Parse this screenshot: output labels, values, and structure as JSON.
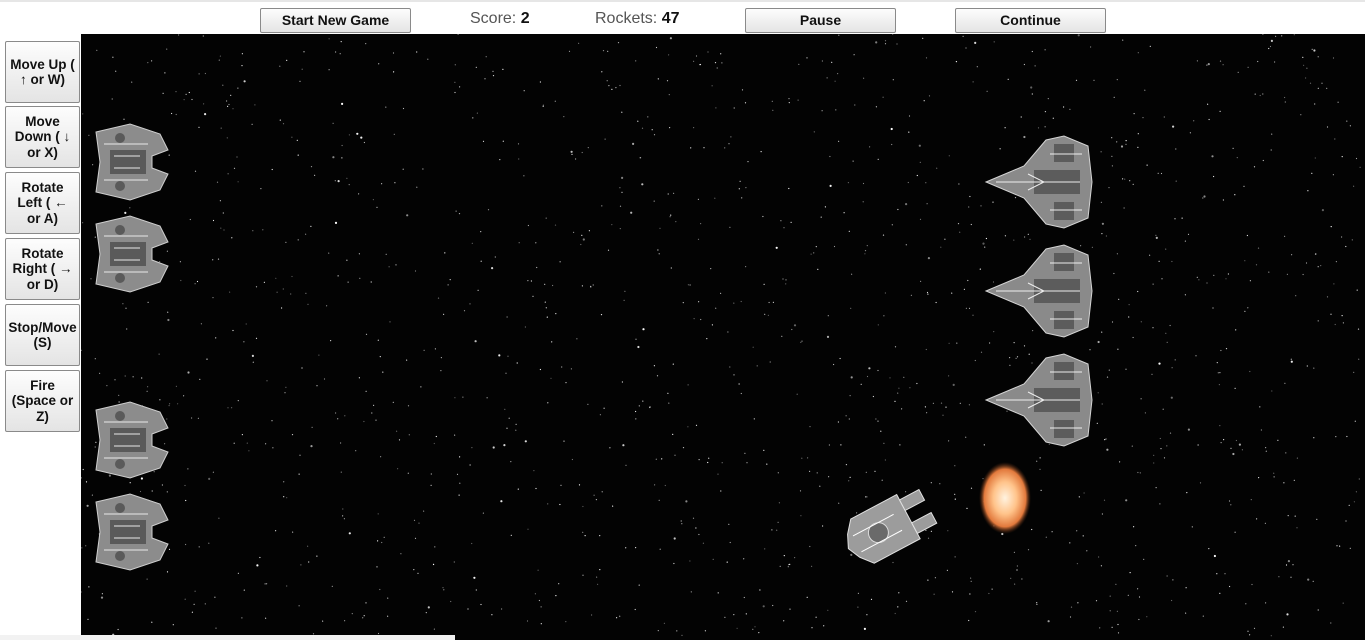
{
  "toolbar": {
    "new_game_label": "Start New Game",
    "score_label": "Score:",
    "score_value": "2",
    "rockets_label": "Rockets:",
    "rockets_value": "47",
    "pause_label": "Pause",
    "continue_label": "Continue"
  },
  "controls": [
    {
      "label": "Move Up ( ↑ or W)"
    },
    {
      "label": "Move Down ( ↓ or X)"
    },
    {
      "label": "Rotate Left ( ← or A)"
    },
    {
      "label": "Rotate Right ( → or D)"
    },
    {
      "label": "Stop/Move (S)"
    },
    {
      "label": "Fire (Space or Z)"
    }
  ],
  "colors": {
    "space": "#030303",
    "star": "#ffffff",
    "ship_hull": "#9a9a9a",
    "explosion": "#f0a070"
  },
  "game": {
    "player_ship": "player-freighter-sprite",
    "left_fleet": "left-cruiser-sprite",
    "right_fleet": "enemy-destroyer-sprite",
    "effect": "explosion-sprite"
  }
}
